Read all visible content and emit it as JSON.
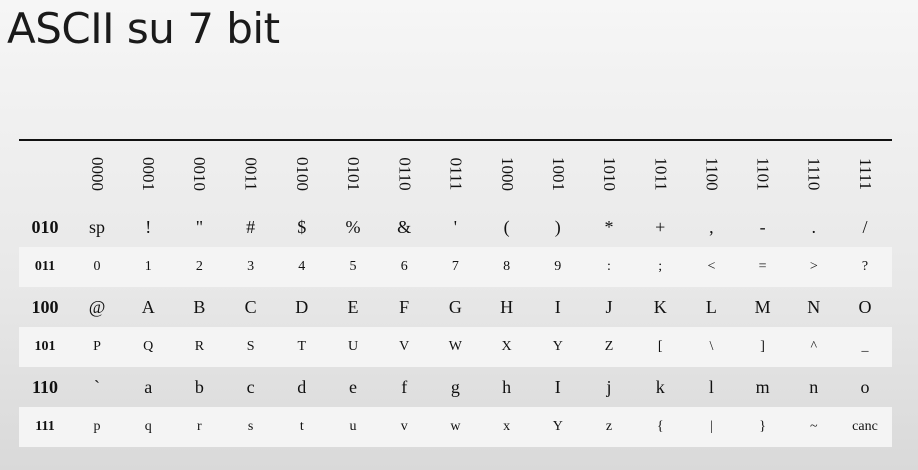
{
  "title": "ASCII su 7 bit",
  "columns": [
    "0000",
    "0001",
    "0010",
    "0011",
    "0100",
    "0101",
    "0110",
    "0111",
    "1000",
    "1001",
    "1010",
    "1011",
    "1100",
    "1101",
    "1110",
    "1111"
  ],
  "rows": [
    {
      "label": "010",
      "cells": [
        "sp",
        "!",
        "\"",
        "#",
        "$",
        "%",
        "&",
        "'",
        "(",
        ")",
        "*",
        "+",
        ",",
        "-",
        ".",
        "/"
      ]
    },
    {
      "label": "011",
      "cells": [
        "0",
        "1",
        "2",
        "3",
        "4",
        "5",
        "6",
        "7",
        "8",
        "9",
        ":",
        ";",
        "<",
        "=",
        ">",
        "?"
      ]
    },
    {
      "label": "100",
      "cells": [
        "@",
        "A",
        "B",
        "C",
        "D",
        "E",
        "F",
        "G",
        "H",
        "I",
        "J",
        "K",
        "L",
        "M",
        "N",
        "O"
      ]
    },
    {
      "label": "101",
      "cells": [
        "P",
        "Q",
        "R",
        "S",
        "T",
        "U",
        "V",
        "W",
        "X",
        "Y",
        "Z",
        "[",
        "\\",
        "]",
        "^",
        "_"
      ]
    },
    {
      "label": "110",
      "cells": [
        "`",
        "a",
        "b",
        "c",
        "d",
        "e",
        "f",
        "g",
        "h",
        "I",
        "j",
        "k",
        "l",
        "m",
        "n",
        "o"
      ]
    },
    {
      "label": "111",
      "cells": [
        "p",
        "q",
        "r",
        "s",
        "t",
        "u",
        "v",
        "w",
        "x",
        "Y",
        "z",
        "{",
        "|",
        "}",
        "~",
        "canc"
      ]
    }
  ]
}
